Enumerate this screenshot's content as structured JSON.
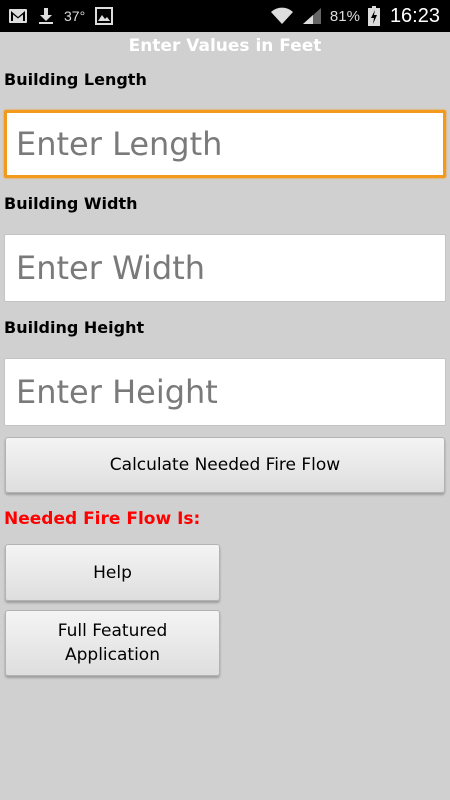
{
  "status_bar": {
    "icons_left": [
      "gmail-icon",
      "download-icon",
      "image-icon"
    ],
    "temperature": "37°",
    "icons_right": [
      "wifi-icon",
      "signal-icon",
      "battery-charging-icon"
    ],
    "battery_percent": "81%",
    "time": "16:23"
  },
  "header": {
    "title": "Enter Values in Feet"
  },
  "form": {
    "length_label": "Building Length",
    "length_placeholder": "Enter Length",
    "width_label": "Building Width",
    "width_placeholder": "Enter Width",
    "height_label": "Building Height",
    "height_placeholder": "Enter Height",
    "calculate_label": "Calculate Needed Fire Flow"
  },
  "result": {
    "label": "Needed Fire Flow Is:"
  },
  "buttons": {
    "help_label": "Help",
    "full_app_label": "Full Featured\nApplication"
  },
  "colors": {
    "background": "#d0d0d0",
    "focus": "#f39a1e",
    "result_text": "#ff0000"
  }
}
